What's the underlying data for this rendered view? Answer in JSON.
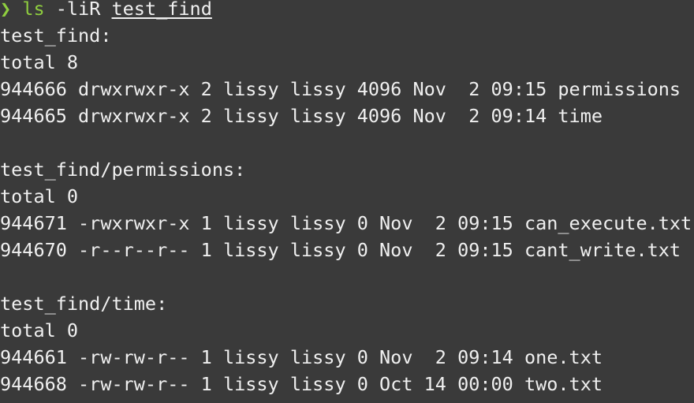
{
  "prompt": {
    "symbol": "❯",
    "command": "ls",
    "args": "-liR",
    "path": "test_find"
  },
  "sections": [
    {
      "header": "test_find:",
      "total": "total 8",
      "entries": [
        "944666 drwxrwxr-x 2 lissy lissy 4096 Nov  2 09:15 permissions",
        "944665 drwxrwxr-x 2 lissy lissy 4096 Nov  2 09:14 time"
      ]
    },
    {
      "header": "test_find/permissions:",
      "total": "total 0",
      "entries": [
        "944671 -rwxrwxr-x 1 lissy lissy 0 Nov  2 09:15 can_execute.txt",
        "944670 -r--r--r-- 1 lissy lissy 0 Nov  2 09:15 cant_write.txt"
      ]
    },
    {
      "header": "test_find/time:",
      "total": "total 0",
      "entries": [
        "944661 -rw-rw-r-- 1 lissy lissy 0 Nov  2 09:14 one.txt",
        "944668 -rw-rw-r-- 1 lissy lissy 0 Oct 14 00:00 two.txt"
      ]
    }
  ],
  "colors": {
    "background": "#3a3a3a",
    "foreground": "#f0f0f0",
    "prompt_accent": "#8fce3f"
  }
}
